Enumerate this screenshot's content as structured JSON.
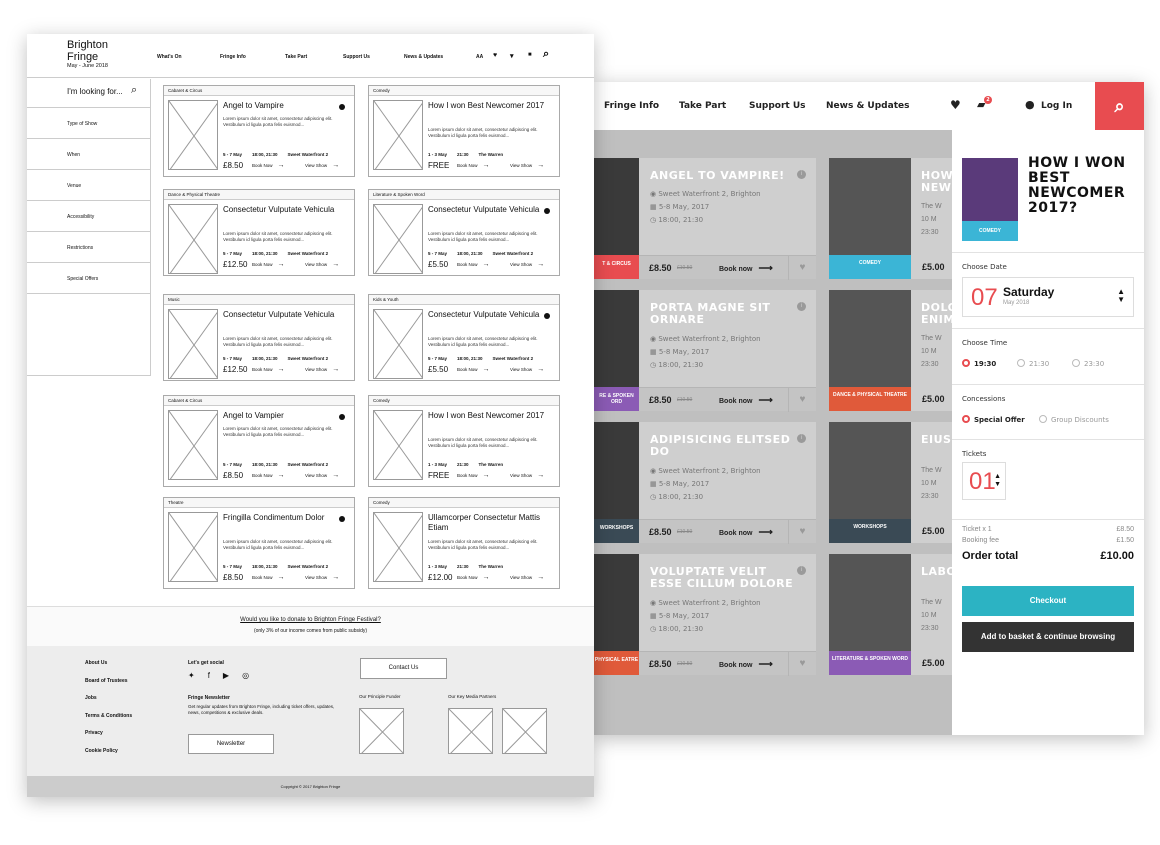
{
  "wireframe": {
    "logo": {
      "line1": "Brighton",
      "line2": "Fringe",
      "dates": "May - June 2018"
    },
    "nav": [
      "What's On",
      "Fringe Info",
      "Take Part",
      "Support Us",
      "News & Updates"
    ],
    "icons": {
      "text_size": "AA"
    },
    "search_placeholder": "I'm looking for...",
    "filters": [
      "Type of Show",
      "When",
      "Venue",
      "Accessibility",
      "Restrictions",
      "Special Offers"
    ],
    "cards": [
      {
        "category": "Cabaret & Circus",
        "title": "Angel to Vampire",
        "body": "Lorem ipsum dolor sit amet, consectetur adipiscing elit. Vestibulum id ligula porta felis euismod...",
        "dates": "5 - 7 May",
        "time": "18:00, 21:30",
        "venue": "Sweet Waterfront 2",
        "price": "£8.50",
        "book": "Book Now",
        "view": "View Show",
        "info": true
      },
      {
        "category": "Comedy",
        "title": "How I won Best Newcomer 2017",
        "body": "Lorem ipsum dolor sit amet, consectetur adipiscing elit. Vestibulum id ligula porta felis euismod...",
        "dates": "1 - 3 May",
        "time": "21:30",
        "venue": "The Warren",
        "price": "FREE",
        "book": "Book Now",
        "view": "View Show",
        "info": false
      },
      {
        "category": "Dance & Physical Theatre",
        "title": "Consectetur Vulputate Vehicula",
        "body": "Lorem ipsum dolor sit amet, consectetur adipiscing elit. Vestibulum id ligula porta felis euismod...",
        "dates": "5 - 7 May",
        "time": "18:00, 21:30",
        "venue": "Sweet Waterfront 2",
        "price": "£12.50",
        "book": "Book Now",
        "view": "View Show",
        "info": false
      },
      {
        "category": "Literature & Spoken Word",
        "title": "Consectetur Vulputate Vehicula",
        "body": "Lorem ipsum dolor sit amet, consectetur adipiscing elit. Vestibulum id ligula porta felis euismod...",
        "dates": "5 - 7 May",
        "time": "18:00, 21:30",
        "venue": "Sweet Waterfront 2",
        "price": "£5.50",
        "book": "Book Now",
        "view": "View Show",
        "info": true
      },
      {
        "category": "Music",
        "title": "Consectetur Vulputate Vehicula",
        "body": "Lorem ipsum dolor sit amet, consectetur adipiscing elit. Vestibulum id ligula porta felis euismod...",
        "dates": "5 - 7 May",
        "time": "18:00, 21:30",
        "venue": "Sweet Waterfront 2",
        "price": "£12.50",
        "book": "Book Now",
        "view": "View Show",
        "info": false
      },
      {
        "category": "Kids & Youth",
        "title": "Consectetur Vulputate Vehicula",
        "body": "Lorem ipsum dolor sit amet, consectetur adipiscing elit. Vestibulum id ligula porta felis euismod...",
        "dates": "5 - 7 May",
        "time": "18:00, 21:30",
        "venue": "Sweet Waterfront 2",
        "price": "£5.50",
        "book": "Book Now",
        "view": "View Show",
        "info": true
      },
      {
        "category": "Cabaret & Circus",
        "title": "Angel to Vampier",
        "body": "Lorem ipsum dolor sit amet, consectetur adipiscing elit. Vestibulum id ligula porta felis euismod...",
        "dates": "5 - 7 May",
        "time": "18:00, 21:30",
        "venue": "Sweet Waterfront 2",
        "price": "£8.50",
        "book": "Book Now",
        "view": "View Show",
        "info": true
      },
      {
        "category": "Comedy",
        "title": "How I won Best Newcomer 2017",
        "body": "Lorem ipsum dolor sit amet, consectetur adipiscing elit. Vestibulum id ligula porta felis euismod...",
        "dates": "1 - 3 May",
        "time": "21:30",
        "venue": "The Warren",
        "price": "FREE",
        "book": "Book Now",
        "view": "View Show",
        "info": false
      },
      {
        "category": "Theatre",
        "title": "Fringilla Condimentum Dolor",
        "body": "Lorem ipsum dolor sit amet, consectetur adipiscing elit. Vestibulum id ligula porta felis euismod...",
        "dates": "5 - 7 May",
        "time": "18:00, 21:30",
        "venue": "Sweet Waterfront 2",
        "price": "£8.50",
        "book": "Book Now",
        "view": "View Show",
        "info": true
      },
      {
        "category": "Comedy",
        "title": "Ullamcorper Consectetur Mattis Etiam",
        "body": "Lorem ipsum dolor sit amet, consectetur adipiscing elit. Vestibulum id ligula porta felis euismod...",
        "dates": "1 - 3 May",
        "time": "21:30",
        "venue": "The Warren",
        "price": "£12.00",
        "book": "Book Now",
        "view": "View Show",
        "info": false
      }
    ],
    "donate": {
      "link": "Would you like to donate to Brighton Fringe Festival?",
      "note": "(only 3% of our income comes from public subsidy)"
    },
    "footer_links": [
      "About Us",
      "Board of Trustees",
      "Jobs",
      "Terms & Conditions",
      "Privacy",
      "Cookie Policy"
    ],
    "social_title": "Let's get social",
    "newsletter": {
      "title": "Fringe Newsletter",
      "text": "Get regular updates from Brighton Fringe, including ticket offers, updates, news, competitions & exclusive deals.",
      "button": "Newsletter"
    },
    "contact_button": "Contact Us",
    "funder_label": "Our Principle Funder",
    "partners_label": "Our Key Media Partners",
    "copyright": "Copyright © 2017 Brighton Fringe"
  },
  "hifi": {
    "nav": [
      "Fringe Info",
      "Take Part",
      "Support Us",
      "News & Updates"
    ],
    "cart_count": "2",
    "login": "Log In",
    "cards": [
      {
        "title": "ANGEL TO VAMPIRE!",
        "venue": "Sweet Waterfront 2, Brighton",
        "dates": "5-8 May, 2017",
        "time": "18:00, 21:30",
        "tag": "T & CIRCUS",
        "price": "£8.50",
        "old": "£10.50",
        "book": "Book now",
        "color": "#e84c50"
      },
      {
        "title": "PORTA MAGNE SIT ORNARE",
        "venue": "Sweet Waterfront 2, Brighton",
        "dates": "5-8 May, 2017",
        "time": "18:00, 21:30",
        "tag": "RE & SPOKEN ORD",
        "price": "£8.50",
        "old": "£10.50",
        "book": "Book now",
        "color": "#8b5bb5"
      },
      {
        "title": "ADIPISICING ELITSED DO",
        "venue": "Sweet Waterfront 2, Brighton",
        "dates": "5-8 May, 2017",
        "time": "18:00, 21:30",
        "tag": "WORKSHOPS",
        "price": "£8.50",
        "old": "£10.50",
        "book": "Book now",
        "color": "#3a4a55"
      },
      {
        "title": "VOLUPTATE VELIT ESSE CILLUM DOLORE",
        "venue": "Sweet Waterfront 2, Brighton",
        "dates": "5-8 May, 2017",
        "time": "18:00, 21:30",
        "tag": "PHYSICAL EATRE",
        "price": "£8.50",
        "old": "£10.50",
        "book": "Book now",
        "color": "#e05a3a"
      }
    ],
    "right_cards": [
      {
        "title": "HOW NEWC",
        "l1": "The W",
        "l2": "10 M",
        "l3": "23:30",
        "tag": "COMEDY",
        "price": "£5.00",
        "color": "#3bb5d6"
      },
      {
        "title": "DOLO ENIM",
        "l1": "The W",
        "l2": "10 M",
        "l3": "23:30",
        "tag": "DANCE & PHYSICAL THEATRE",
        "price": "£5.00",
        "color": "#e05a3a"
      },
      {
        "title": "EIUSM",
        "l1": "The W",
        "l2": "10 M",
        "l3": "23:30",
        "tag": "WORKSHOPS",
        "price": "£5.00",
        "color": "#3a4a55"
      },
      {
        "title": "LABO",
        "l1": "The W",
        "l2": "10 M",
        "l3": "23:30",
        "tag": "LITERATURE & SPOKEN WORD",
        "price": "£5.00",
        "color": "#8b5bb5"
      }
    ],
    "panel": {
      "title": "HOW I WON BEST NEWCOMER 2017?",
      "tag": "COMEDY",
      "choose_date": "Choose Date",
      "date_num": "07",
      "date_day": "Saturday",
      "date_month": "May 2018",
      "choose_time": "Choose Time",
      "times": [
        "19:30",
        "21:30",
        "23:30"
      ],
      "concessions": "Concessions",
      "conc_options": [
        "Special Offer",
        "Group Discounts"
      ],
      "tickets": "Tickets",
      "ticket_count": "01",
      "line1_label": "Ticket x 1",
      "line1_value": "£8.50",
      "line2_label": "Booking fee",
      "line2_value": "£1.50",
      "total_label": "Order total",
      "total_value": "£10.00",
      "checkout": "Checkout",
      "add_basket": "Add to basket & continue browsing"
    }
  }
}
